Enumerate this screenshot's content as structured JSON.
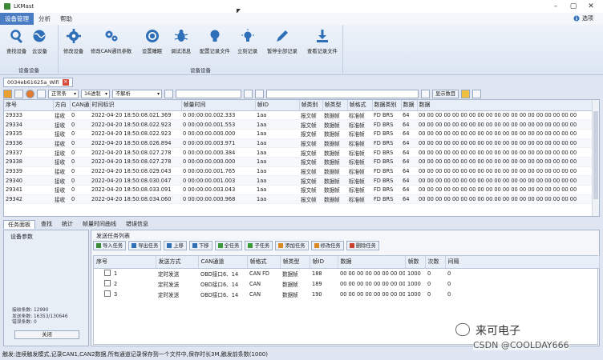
{
  "window": {
    "title": "LKMast",
    "controls": [
      "–",
      "▢",
      "✕"
    ]
  },
  "menu": {
    "tabs": [
      "设备管理",
      "分析",
      "帮助"
    ],
    "about": "选项"
  },
  "ribbon": {
    "groups": [
      {
        "label": "设备设备",
        "buttons": [
          "查找设备",
          "云设备"
        ]
      },
      {
        "label": "设备设备",
        "buttons": [
          "修改设备",
          "修改CAN通讯参数",
          "设置睡眠",
          "调试消息",
          "配置记录文件",
          "立刻记录",
          "暂停全部记录",
          "查看记录文件"
        ]
      }
    ]
  },
  "doc_tab": {
    "label": "0034eb61625a_Wifi"
  },
  "toolbar": {
    "mode": "正常条",
    "radix": "16进制",
    "filter": "不解析",
    "display_btn": "显示数目"
  },
  "grid": {
    "columns": [
      "序号",
      "方向",
      "CAN通",
      "时间标识",
      "帧量时间",
      "帧ID",
      "帧类别",
      "帧类型",
      "帧格式",
      "数据类别",
      "数据",
      "数据"
    ],
    "rows": [
      [
        "29333",
        "接收",
        "0",
        "2022-04-20 18:50:08.021.369",
        "0 00:00:00.002.333",
        "1aa",
        "报文帧",
        "数据帧",
        "标准帧",
        "FD BRS",
        "64",
        "00 00 00 00 00 00 00 00 00 00 00 00 00 00 00 00 00 00 00"
      ],
      [
        "29334",
        "接收",
        "0",
        "2022-04-20 18:50:08.022.923",
        "0 00:00:00.001.553",
        "1aa",
        "报文帧",
        "数据帧",
        "标准帧",
        "FD BRS",
        "64",
        "00 00 00 00 00 00 00 00 00 00 00 00 00 00 00 00 00 00 00"
      ],
      [
        "29335",
        "接收",
        "0",
        "2022-04-20 18:50:08.022.923",
        "0 00:00:00.000.000",
        "1aa",
        "报文帧",
        "数据帧",
        "标准帧",
        "FD BRS",
        "64",
        "00 00 00 00 00 00 00 00 00 00 00 00 00 00 00 00 00 00 00"
      ],
      [
        "29336",
        "接收",
        "0",
        "2022-04-20 18:50:08.026.894",
        "0 00:00:00.003.971",
        "1aa",
        "报文帧",
        "数据帧",
        "标准帧",
        "FD BRS",
        "64",
        "00 00 00 00 00 00 00 00 00 00 00 00 00 00 00 00 00 00 00"
      ],
      [
        "29337",
        "接收",
        "0",
        "2022-04-20 18:50:08.027.278",
        "0 00:00:00.000.384",
        "1aa",
        "报文帧",
        "数据帧",
        "标准帧",
        "FD BRS",
        "64",
        "00 00 00 00 00 00 00 00 00 00 00 00 00 00 00 00 00 00 00"
      ],
      [
        "29338",
        "接收",
        "0",
        "2022-04-20 18:50:08.027.278",
        "0 00:00:00.000.000",
        "1aa",
        "报文帧",
        "数据帧",
        "标准帧",
        "FD BRS",
        "64",
        "00 00 00 00 00 00 00 00 00 00 00 00 00 00 00 00 00 00 00"
      ],
      [
        "29339",
        "接收",
        "0",
        "2022-04-20 18:50:08.029.043",
        "0 00:00:00.001.765",
        "1aa",
        "报文帧",
        "数据帧",
        "标准帧",
        "FD BRS",
        "64",
        "00 00 00 00 00 00 00 00 00 00 00 00 00 00 00 00 00 00 00"
      ],
      [
        "29340",
        "接收",
        "0",
        "2022-04-20 18:50:08.030.047",
        "0 00:00:00.001.003",
        "1aa",
        "报文帧",
        "数据帧",
        "标准帧",
        "FD BRS",
        "64",
        "00 00 00 00 00 00 00 00 00 00 00 00 00 00 00 00 00 00 00"
      ],
      [
        "29341",
        "接收",
        "0",
        "2022-04-20 18:50:08.033.091",
        "0 00:00:00.003.043",
        "1aa",
        "报文帧",
        "数据帧",
        "标准帧",
        "FD BRS",
        "64",
        "00 00 00 00 00 00 00 00 00 00 00 00 00 00 00 00 00 00 00"
      ],
      [
        "29342",
        "接收",
        "0",
        "2022-04-20 18:50:08.034.060",
        "0 00:00:00.000.968",
        "1aa",
        "报文帧",
        "数据帧",
        "标准帧",
        "FD BRS",
        "64",
        "00 00 00 00 00 00 00 00 00 00 00 00 00 00 00 00 00 00 00"
      ]
    ]
  },
  "bottom_tabs": [
    "任务面板",
    "查找",
    "统计",
    "帧量时间曲线",
    "错误信息"
  ],
  "left_panel": {
    "title": "设备参数",
    "stats": [
      "接收条数: 12990",
      "发送条数: 16353/130646",
      "错误条数: 0"
    ],
    "close": "关闭"
  },
  "send_panel": {
    "title": "发送任务列表",
    "buttons": [
      "导入任务",
      "导出任务",
      "上移",
      "下移",
      "全任务",
      "子任务",
      "添加任务",
      "修改任务",
      "删除任务"
    ],
    "columns": [
      "序号",
      "发送方式",
      "CAN通道",
      "帧格式",
      "帧类型",
      "帧ID",
      "数据",
      "帧数",
      "次数",
      "间隔"
    ],
    "rows": [
      [
        "1",
        "定时发送",
        "OBD接口6、14",
        "CAN FD",
        "数据帧",
        "188",
        "00 00 00 00 00 00 00 00 ...",
        "1000",
        "0",
        "0"
      ],
      [
        "2",
        "定时发送",
        "OBD接口6、14",
        "CAN",
        "数据帧",
        "189",
        "00 00 00 00 00 00 00 00 ...",
        "1000",
        "0",
        "0"
      ],
      [
        "3",
        "定时发送",
        "OBD接口6、14",
        "CAN",
        "数据帧",
        "190",
        "00 00 00 00 00 00 00 00 ...",
        "1000",
        "0",
        "0"
      ]
    ]
  },
  "status": "触发:连续触发模式,记录CAN1,CAN2数据,所有通道记录保存到一个文件中,保存时长3M,触发前条数(1000)",
  "watermark": {
    "brand": "来可电子",
    "credit": "CSDN @COOLDAY666"
  },
  "colors": {
    "accent": "#4a7cc4",
    "icon_blue": "#2e6fb8",
    "header_bg": "#e8eef7"
  }
}
